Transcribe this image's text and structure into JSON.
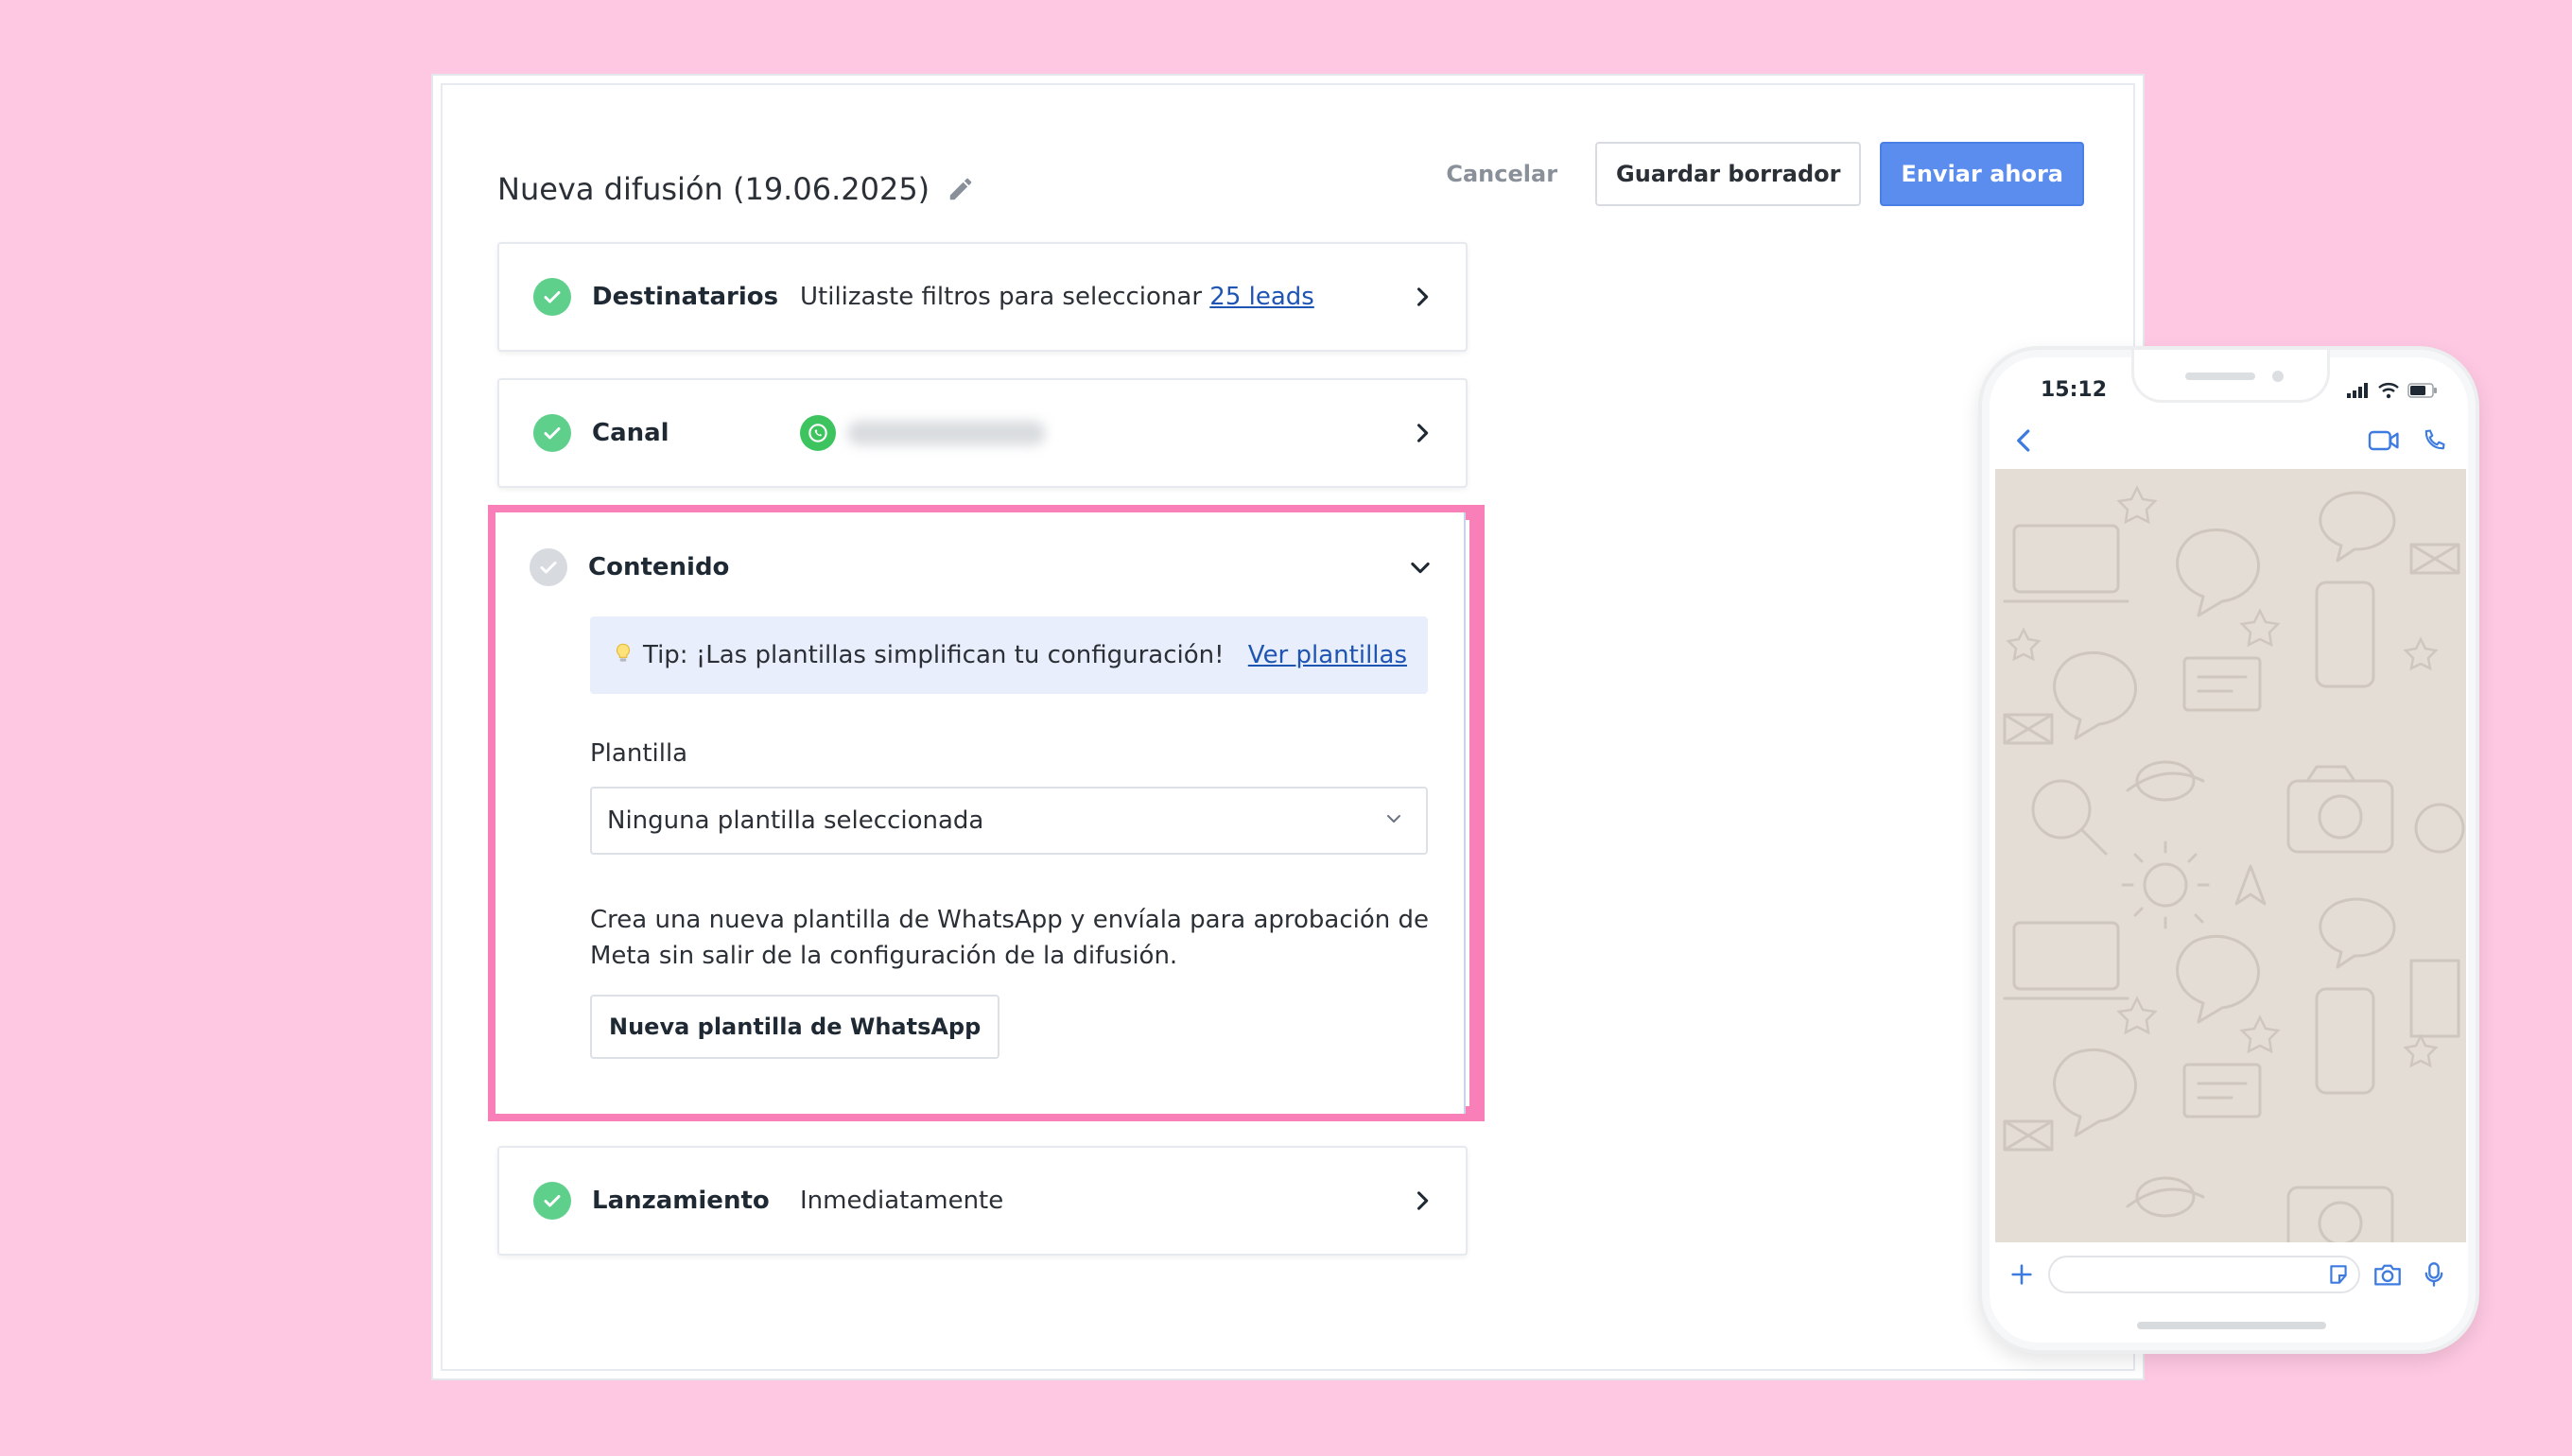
{
  "header": {
    "title": "Nueva difusión (19.06.2025)",
    "cancel_label": "Cancelar",
    "save_draft_label": "Guardar borrador",
    "send_now_label": "Enviar ahora"
  },
  "sections": {
    "recipients": {
      "label": "Destinatarios",
      "value_prefix": "Utilizaste filtros para seleccionar",
      "value_link": "25 leads",
      "status": "done"
    },
    "channel": {
      "label": "Canal",
      "status": "done"
    },
    "content": {
      "label": "Contenido",
      "status": "pending",
      "tip_text": "Tip: ¡Las plantillas simplifican tu configuración!",
      "tip_link": "Ver plantillas",
      "template_label": "Plantilla",
      "template_value": "Ninguna plantilla seleccionada",
      "help_text": "Crea una nueva plantilla de WhatsApp y envíala para aprobación de Meta sin salir de la configuración de la difusión.",
      "new_template_button": "Nueva plantilla de WhatsApp"
    },
    "launch": {
      "label": "Lanzamiento",
      "value": "Inmediatamente",
      "status": "done"
    }
  },
  "phone_preview": {
    "time": "15:12"
  },
  "colors": {
    "background": "#fec8e2",
    "highlight": "#f97fb8",
    "primary": "#5b8def",
    "check_done": "#5fcf8c",
    "check_pending": "#d7dadf",
    "link": "#1e55b3",
    "whatsapp": "#3ec45f",
    "tip_bg": "#e8eefb",
    "chat_bg": "#e3ddd6"
  }
}
